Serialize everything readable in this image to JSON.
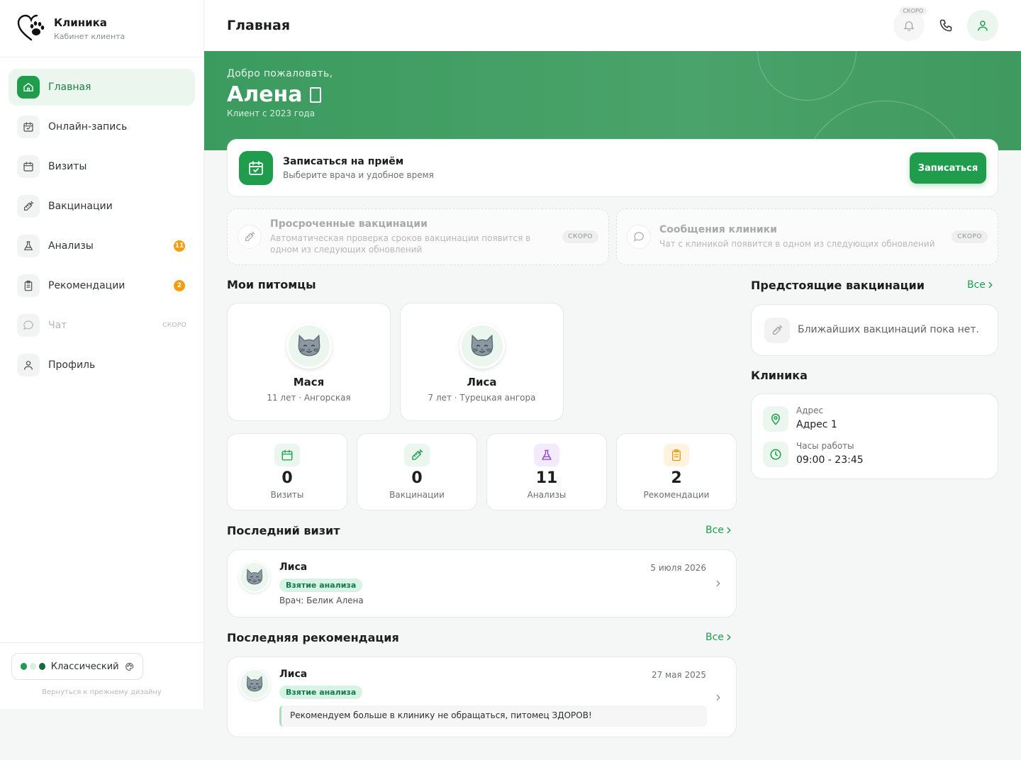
{
  "sidebar": {
    "brand_title": "Клиника",
    "brand_subtitle": "Кабинет клиента",
    "items": [
      {
        "label": "Главная",
        "icon": "home-icon"
      },
      {
        "label": "Онлайн-запись",
        "icon": "calendar-check-icon"
      },
      {
        "label": "Визиты",
        "icon": "calendar-icon"
      },
      {
        "label": "Вакцинации",
        "icon": "syringe-icon"
      },
      {
        "label": "Анализы",
        "icon": "flask-icon",
        "badge": "11"
      },
      {
        "label": "Рекомендации",
        "icon": "clipboard-icon",
        "badge": "2"
      },
      {
        "label": "Чат",
        "icon": "chat-icon",
        "soon": "СКОРО"
      },
      {
        "label": "Профиль",
        "icon": "user-icon"
      }
    ],
    "theme_label": "Классический",
    "back_link": "Вернуться к прежнему дизайну"
  },
  "topbar": {
    "title": "Главная",
    "soon": "СКОРО"
  },
  "hero": {
    "welcome": "Добро пожаловать,",
    "name": "Алена ",
    "since": "Клиент с 2023 года"
  },
  "booking": {
    "title": "Записаться на приём",
    "subtitle": "Выберите врача и удобное время",
    "button": "Записаться"
  },
  "soon_cards": [
    {
      "title": "Просроченные вакцинации",
      "subtitle": "Автоматическая проверка сроков вакцинации появится в одном из следующих обновлений",
      "badge": "СКОРО"
    },
    {
      "title": "Сообщения клиники",
      "subtitle": "Чат с клиникой появится в одном из следующих обновлений",
      "badge": "СКОРО"
    }
  ],
  "pets": {
    "title": "Мои питомцы",
    "items": [
      {
        "name": "Мася",
        "info": "11 лет · Ангорская"
      },
      {
        "name": "Лиса",
        "info": "7 лет · Турецкая ангора"
      }
    ]
  },
  "stats": [
    {
      "value": "0",
      "label": "Визиты",
      "icon": "calendar-icon",
      "color": "#1f9d4d"
    },
    {
      "value": "0",
      "label": "Вакцинации",
      "icon": "syringe-icon",
      "color": "#1f9d4d"
    },
    {
      "value": "11",
      "label": "Анализы",
      "icon": "flask-icon",
      "color": "#8b3fd6"
    },
    {
      "value": "2",
      "label": "Рекомендации",
      "icon": "clipboard-icon",
      "color": "#e59a0b"
    }
  ],
  "last_visit": {
    "title": "Последний визит",
    "all": "Все",
    "pet": "Лиса",
    "date": "5 июля 2026",
    "tag": "Взятие анализа",
    "doctor": "Врач: Белик Алена"
  },
  "last_recommendation": {
    "title": "Последняя рекомендация",
    "all": "Все",
    "pet": "Лиса",
    "date": "27 мая 2025",
    "tag": "Взятие анализа",
    "text": "Рекомендуем больше в клинику не обращаться, питомец ЗДОРОВ!"
  },
  "upcoming": {
    "title": "Предстоящие вакцинации",
    "all": "Все",
    "empty": "Ближайших вакцинаций пока нет."
  },
  "clinic": {
    "title": "Клиника",
    "address_label": "Адрес",
    "address": "Адрес 1",
    "hours_label": "Часы работы",
    "hours": "09:00 - 23:45"
  },
  "colors": {
    "accent": "#1f9d4d",
    "hero": "#4aa36a",
    "badge": "#f59e0b"
  }
}
